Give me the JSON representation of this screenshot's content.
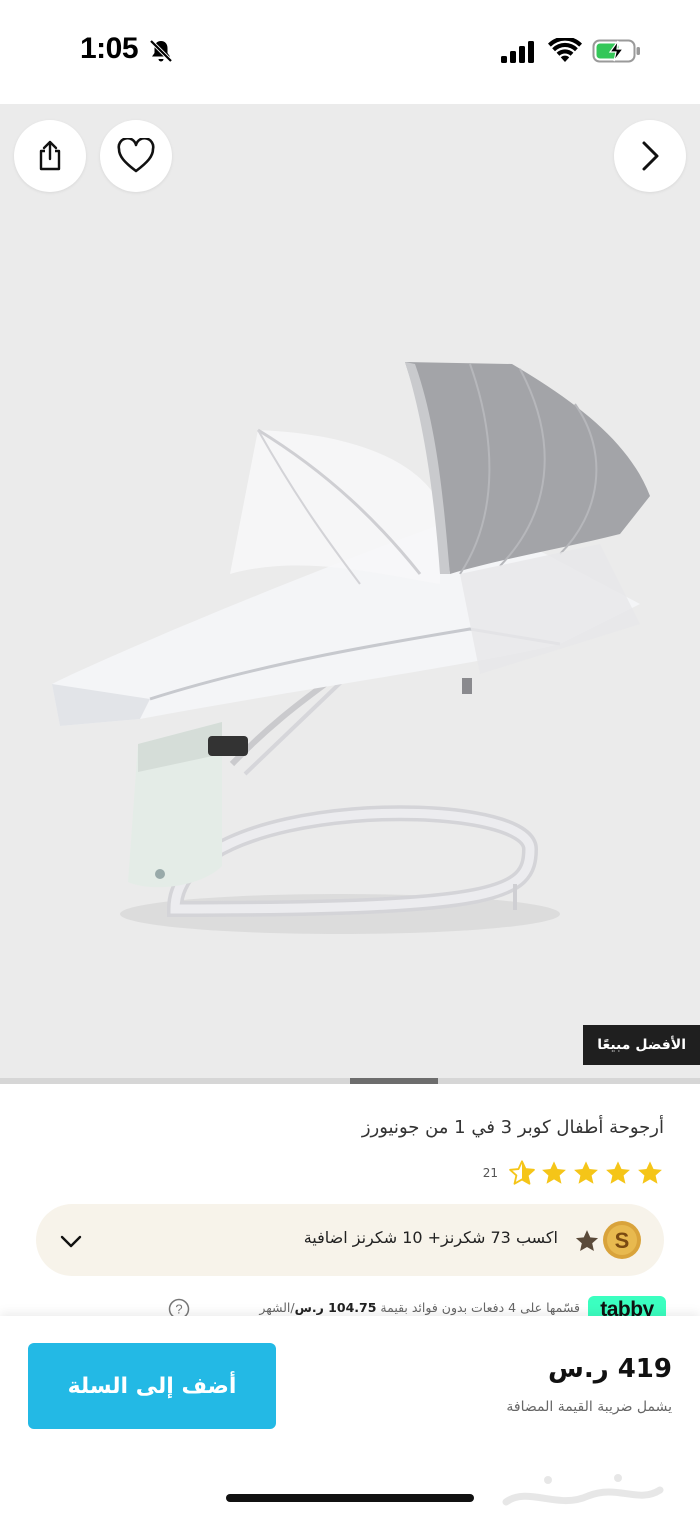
{
  "status_bar": {
    "time": "1:05",
    "icons": [
      "bell-slash-icon",
      "cellular-signal-icon",
      "wifi-icon",
      "battery-charging-icon"
    ]
  },
  "gallery": {
    "actions": [
      "share-icon",
      "heart-icon",
      "chevron-right-icon"
    ],
    "badge": "الأفضل مبيعًا"
  },
  "product": {
    "title": "أرجوحة  أطفال كوبر 3 في 1 من جونيورز",
    "rating": {
      "stars": 4.5,
      "count": "21"
    }
  },
  "shukran": {
    "text": "اكسب 73 شكرنز+  10  شكرنز اضافية"
  },
  "tabby": {
    "logo": "tabby",
    "text_before": "قسّمها على 4 دفعات بدون فوائد بقيمة ",
    "amount": "104.75 ر.س",
    "text_after": "/الشهر"
  },
  "bottom_bar": {
    "add_to_cart_label": "أضف إلى السلة",
    "price": "419 ر.س",
    "vat_note": "يشمل ضريبة القيمة المضافة"
  },
  "colors": {
    "accent": "#23b9e5",
    "star": "#f5c518",
    "tabby": "#3bffc0",
    "badge_bg": "#1f1f1f",
    "shukran_bg": "#f7f3ea"
  }
}
